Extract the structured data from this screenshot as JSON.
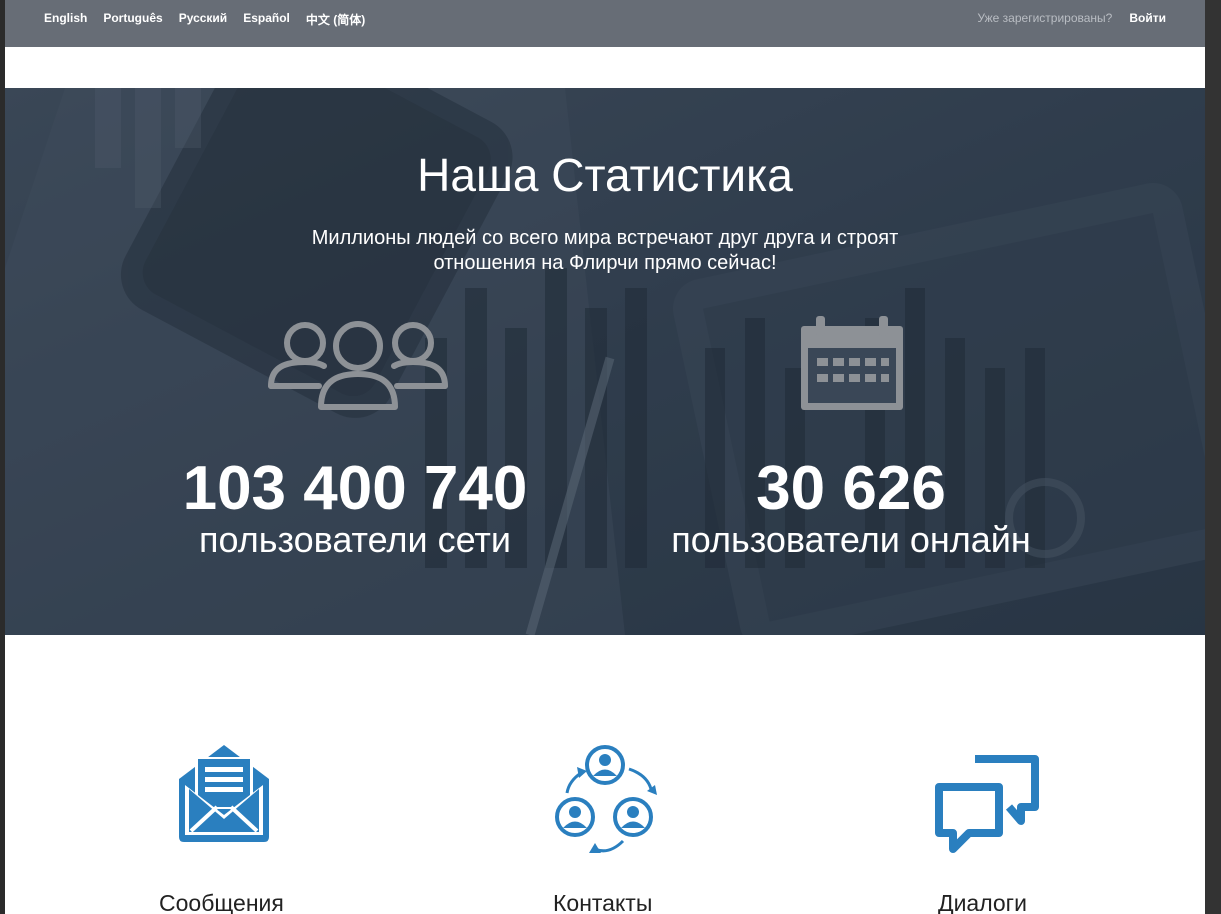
{
  "topbar": {
    "languages": [
      "English",
      "Português",
      "Русский",
      "Español",
      "中文 (简体)"
    ],
    "already_registered": "Уже зарегистрированы?",
    "login_label": "Войти"
  },
  "stats": {
    "title": "Наша Статистика",
    "subtitle_line1": "Миллионы людей со всего мира встречают друг друга и строят",
    "subtitle_line2": "отношения на Флирчи прямо сейчас!",
    "items": [
      {
        "icon": "users-group-icon",
        "value": "103 400 740",
        "label": "пользователи сети"
      },
      {
        "icon": "calendar-icon",
        "value": "30 626",
        "label": "пользователи онлайн"
      }
    ]
  },
  "features": [
    {
      "icon": "envelope-icon",
      "label": "Сообщения"
    },
    {
      "icon": "contacts-cycle-icon",
      "label": "Контакты"
    },
    {
      "icon": "chat-bubbles-icon",
      "label": "Диалоги"
    }
  ],
  "colors": {
    "topbar_bg": "#676d76",
    "hero_bg": "#344152",
    "icon_gray": "#8d9196",
    "feature_blue": "#2a7fbf"
  }
}
